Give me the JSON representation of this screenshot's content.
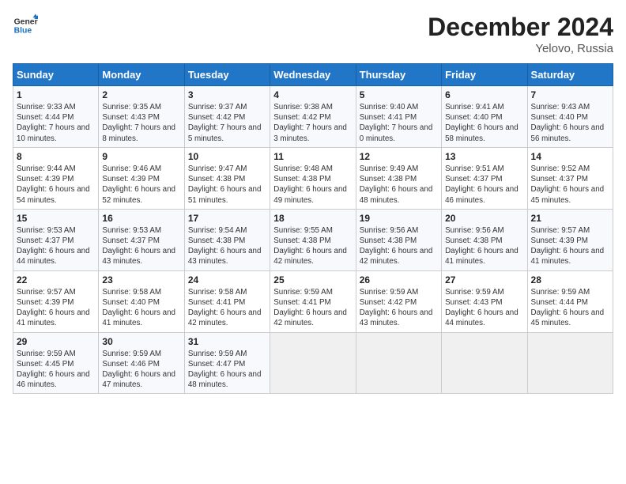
{
  "header": {
    "title": "December 2024",
    "subtitle": "Yelovo, Russia"
  },
  "columns": [
    "Sunday",
    "Monday",
    "Tuesday",
    "Wednesday",
    "Thursday",
    "Friday",
    "Saturday"
  ],
  "weeks": [
    [
      {
        "day": "1",
        "sunrise": "9:33 AM",
        "sunset": "4:44 PM",
        "daylight": "7 hours and 10 minutes."
      },
      {
        "day": "2",
        "sunrise": "9:35 AM",
        "sunset": "4:43 PM",
        "daylight": "7 hours and 8 minutes."
      },
      {
        "day": "3",
        "sunrise": "9:37 AM",
        "sunset": "4:42 PM",
        "daylight": "7 hours and 5 minutes."
      },
      {
        "day": "4",
        "sunrise": "9:38 AM",
        "sunset": "4:42 PM",
        "daylight": "7 hours and 3 minutes."
      },
      {
        "day": "5",
        "sunrise": "9:40 AM",
        "sunset": "4:41 PM",
        "daylight": "7 hours and 0 minutes."
      },
      {
        "day": "6",
        "sunrise": "9:41 AM",
        "sunset": "4:40 PM",
        "daylight": "6 hours and 58 minutes."
      },
      {
        "day": "7",
        "sunrise": "9:43 AM",
        "sunset": "4:40 PM",
        "daylight": "6 hours and 56 minutes."
      }
    ],
    [
      {
        "day": "8",
        "sunrise": "9:44 AM",
        "sunset": "4:39 PM",
        "daylight": "6 hours and 54 minutes."
      },
      {
        "day": "9",
        "sunrise": "9:46 AM",
        "sunset": "4:39 PM",
        "daylight": "6 hours and 52 minutes."
      },
      {
        "day": "10",
        "sunrise": "9:47 AM",
        "sunset": "4:38 PM",
        "daylight": "6 hours and 51 minutes."
      },
      {
        "day": "11",
        "sunrise": "9:48 AM",
        "sunset": "4:38 PM",
        "daylight": "6 hours and 49 minutes."
      },
      {
        "day": "12",
        "sunrise": "9:49 AM",
        "sunset": "4:38 PM",
        "daylight": "6 hours and 48 minutes."
      },
      {
        "day": "13",
        "sunrise": "9:51 AM",
        "sunset": "4:37 PM",
        "daylight": "6 hours and 46 minutes."
      },
      {
        "day": "14",
        "sunrise": "9:52 AM",
        "sunset": "4:37 PM",
        "daylight": "6 hours and 45 minutes."
      }
    ],
    [
      {
        "day": "15",
        "sunrise": "9:53 AM",
        "sunset": "4:37 PM",
        "daylight": "6 hours and 44 minutes."
      },
      {
        "day": "16",
        "sunrise": "9:53 AM",
        "sunset": "4:37 PM",
        "daylight": "6 hours and 43 minutes."
      },
      {
        "day": "17",
        "sunrise": "9:54 AM",
        "sunset": "4:38 PM",
        "daylight": "6 hours and 43 minutes."
      },
      {
        "day": "18",
        "sunrise": "9:55 AM",
        "sunset": "4:38 PM",
        "daylight": "6 hours and 42 minutes."
      },
      {
        "day": "19",
        "sunrise": "9:56 AM",
        "sunset": "4:38 PM",
        "daylight": "6 hours and 42 minutes."
      },
      {
        "day": "20",
        "sunrise": "9:56 AM",
        "sunset": "4:38 PM",
        "daylight": "6 hours and 41 minutes."
      },
      {
        "day": "21",
        "sunrise": "9:57 AM",
        "sunset": "4:39 PM",
        "daylight": "6 hours and 41 minutes."
      }
    ],
    [
      {
        "day": "22",
        "sunrise": "9:57 AM",
        "sunset": "4:39 PM",
        "daylight": "6 hours and 41 minutes."
      },
      {
        "day": "23",
        "sunrise": "9:58 AM",
        "sunset": "4:40 PM",
        "daylight": "6 hours and 41 minutes."
      },
      {
        "day": "24",
        "sunrise": "9:58 AM",
        "sunset": "4:41 PM",
        "daylight": "6 hours and 42 minutes."
      },
      {
        "day": "25",
        "sunrise": "9:59 AM",
        "sunset": "4:41 PM",
        "daylight": "6 hours and 42 minutes."
      },
      {
        "day": "26",
        "sunrise": "9:59 AM",
        "sunset": "4:42 PM",
        "daylight": "6 hours and 43 minutes."
      },
      {
        "day": "27",
        "sunrise": "9:59 AM",
        "sunset": "4:43 PM",
        "daylight": "6 hours and 44 minutes."
      },
      {
        "day": "28",
        "sunrise": "9:59 AM",
        "sunset": "4:44 PM",
        "daylight": "6 hours and 45 minutes."
      }
    ],
    [
      {
        "day": "29",
        "sunrise": "9:59 AM",
        "sunset": "4:45 PM",
        "daylight": "6 hours and 46 minutes."
      },
      {
        "day": "30",
        "sunrise": "9:59 AM",
        "sunset": "4:46 PM",
        "daylight": "6 hours and 47 minutes."
      },
      {
        "day": "31",
        "sunrise": "9:59 AM",
        "sunset": "4:47 PM",
        "daylight": "6 hours and 48 minutes."
      },
      null,
      null,
      null,
      null
    ]
  ]
}
